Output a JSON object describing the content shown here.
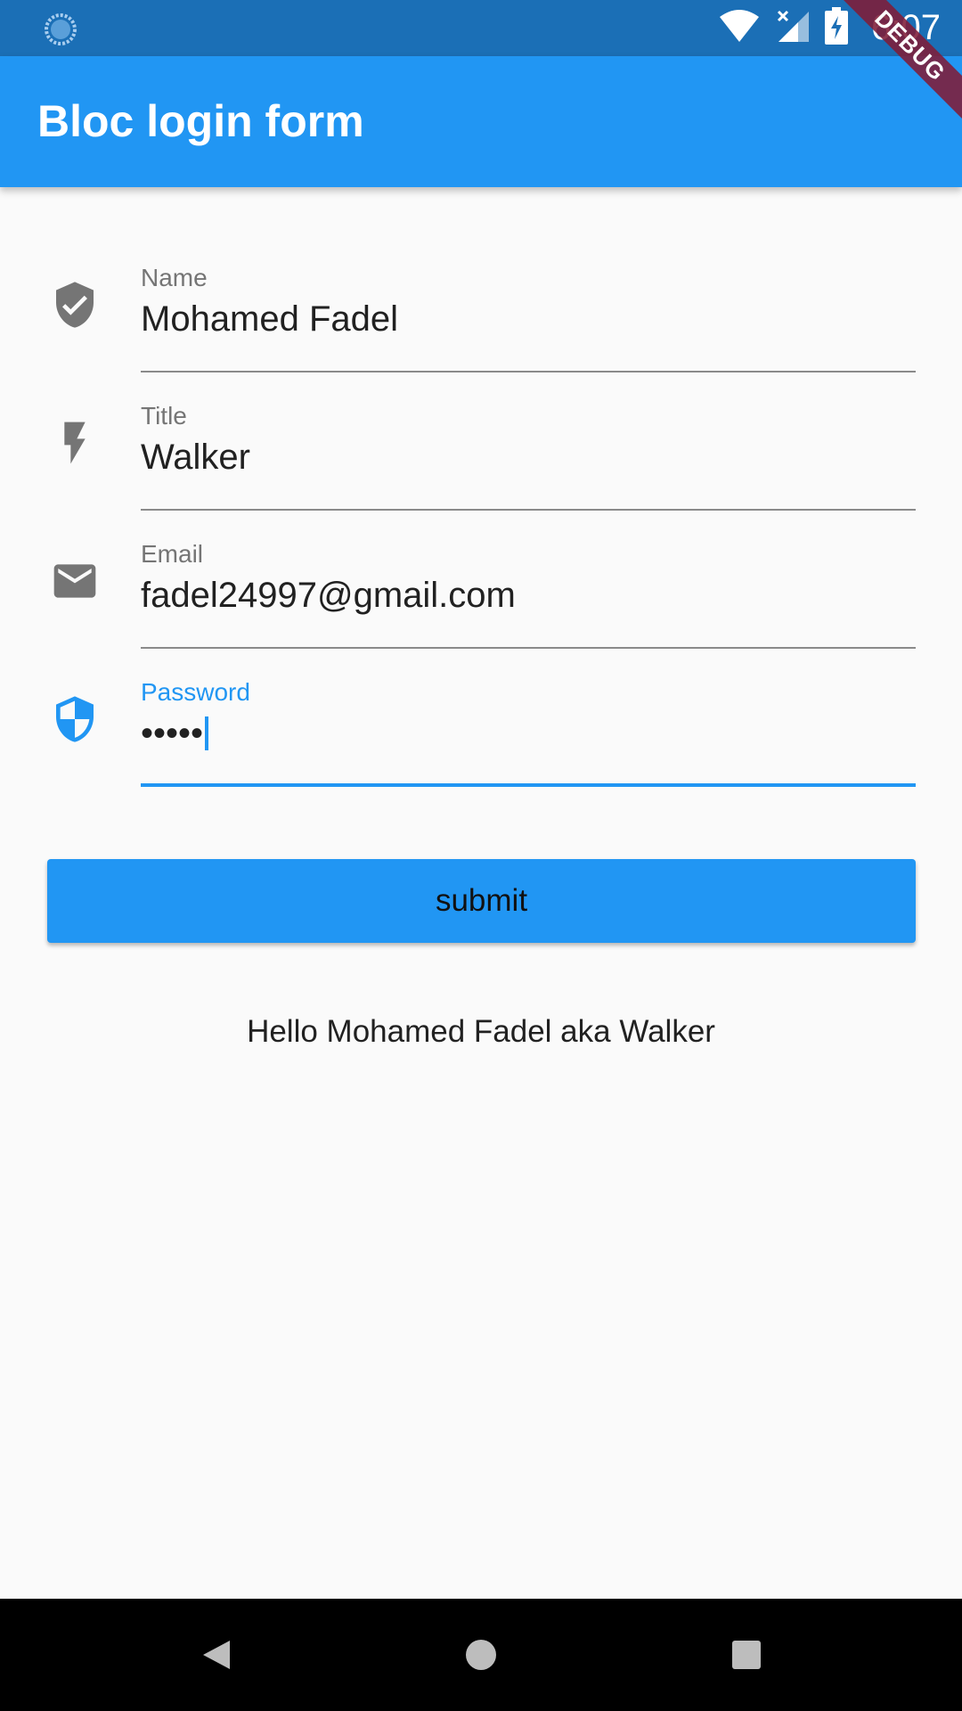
{
  "status_bar": {
    "time": "6:07",
    "icons": [
      "loading-icon",
      "wifi-icon",
      "signal-no-sim-icon",
      "battery-charging-icon"
    ]
  },
  "debug_banner": "DEBUG",
  "app_bar": {
    "title": "Bloc login form"
  },
  "form": {
    "fields": [
      {
        "label": "Name",
        "value": "Mohamed Fadel",
        "icon": "verified-shield-icon",
        "focused": false
      },
      {
        "label": "Title",
        "value": "Walker",
        "icon": "flash-icon",
        "focused": false
      },
      {
        "label": "Email",
        "value": "fadel24997@gmail.com",
        "icon": "email-icon",
        "focused": false
      },
      {
        "label": "Password",
        "value": "•••••",
        "icon": "security-shield-icon",
        "focused": true
      }
    ],
    "submit_label": "submit"
  },
  "greeting": "Hello Mohamed Fadel aka Walker",
  "colors": {
    "primary": "#2196f3",
    "status_bar": "#1b6fb6",
    "icon_grey": "#757575"
  },
  "nav_bar": {
    "buttons": [
      "back-icon",
      "home-icon",
      "recents-icon"
    ]
  }
}
